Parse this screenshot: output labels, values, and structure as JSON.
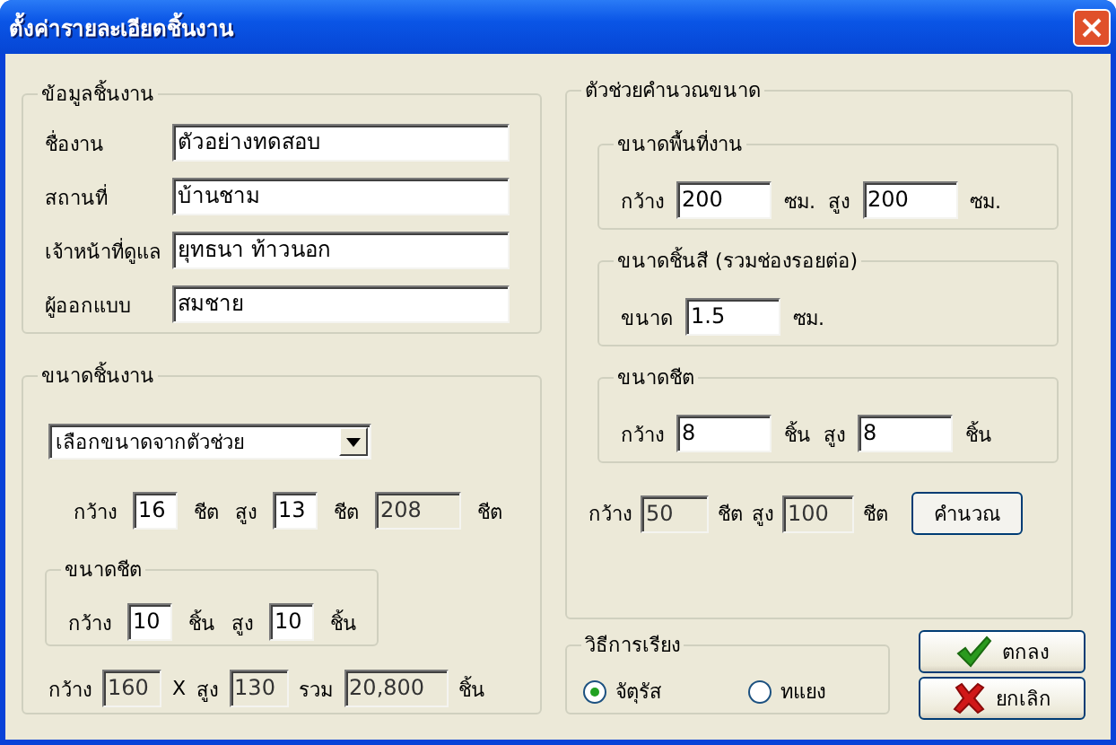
{
  "window": {
    "title": "ตั้งค่ารายละเอียดชิ้นงาน"
  },
  "job_info": {
    "title": "ข้อมูลชิ้นงาน",
    "fields": [
      {
        "label": "ชื่องาน",
        "value": "ตัวอย่างทดสอบ"
      },
      {
        "label": "สถานที่",
        "value": "บ้านชาม"
      },
      {
        "label": "เจ้าหน้าที่ดูแล",
        "value": "ยุทธนา ท้าวนอก"
      },
      {
        "label": "ผู้ออกแบบ",
        "value": "สมชาย"
      }
    ]
  },
  "job_size": {
    "title": "ขนาดชิ้นงาน",
    "dropdown": {
      "value": "เลือกขนาดจากตัวช่วย"
    },
    "size_row": [
      {
        "kind": "label",
        "text": "กว้าง"
      },
      {
        "kind": "input",
        "text": "16"
      },
      {
        "kind": "label",
        "text": "ชีต"
      },
      {
        "kind": "label",
        "text": "สูง"
      },
      {
        "kind": "input",
        "text": "13"
      },
      {
        "kind": "label",
        "text": "ชีต"
      },
      {
        "kind": "readonly",
        "text": "208"
      },
      {
        "kind": "label",
        "text": "ชีต"
      }
    ],
    "sheet_size": {
      "title": "ขนาดชีต",
      "row": [
        {
          "kind": "label",
          "text": "กว้าง"
        },
        {
          "kind": "input",
          "text": "10"
        },
        {
          "kind": "label",
          "text": "ชิ้น"
        },
        {
          "kind": "label",
          "text": "สูง"
        },
        {
          "kind": "input",
          "text": "10"
        },
        {
          "kind": "label",
          "text": "ชิ้น"
        }
      ]
    },
    "result_row": [
      {
        "kind": "label",
        "text": "กว้าง"
      },
      {
        "kind": "readonly",
        "text": "160"
      },
      {
        "kind": "label",
        "text": "X"
      },
      {
        "kind": "label",
        "text": "สูง"
      },
      {
        "kind": "readonly",
        "text": "130"
      },
      {
        "kind": "label",
        "text": "รวม"
      },
      {
        "kind": "readonly",
        "text": "20,800"
      },
      {
        "kind": "label",
        "text": "ชิ้น"
      }
    ]
  },
  "calculator": {
    "title": "ตัวช่วยคำนวณขนาด",
    "groups": [
      {
        "title": "ขนาดพื้นที่งาน",
        "row": [
          {
            "kind": "label",
            "text": "กว้าง"
          },
          {
            "kind": "input",
            "text": "200"
          },
          {
            "kind": "label",
            "text": "ซม."
          },
          {
            "kind": "label",
            "text": "สูง"
          },
          {
            "kind": "input",
            "text": "200"
          },
          {
            "kind": "label",
            "text": "ซม."
          }
        ]
      },
      {
        "title": "ขนาดชิ้นสี (รวมช่องรอยต่อ)",
        "row": [
          {
            "kind": "label",
            "text": "ขนาด"
          },
          {
            "kind": "input",
            "text": "1.5"
          },
          {
            "kind": "label",
            "text": "ซม."
          }
        ]
      },
      {
        "title": "ขนาดชีต",
        "row": [
          {
            "kind": "label",
            "text": "กว้าง"
          },
          {
            "kind": "input",
            "text": "8"
          },
          {
            "kind": "label",
            "text": "ชิ้น"
          },
          {
            "kind": "label",
            "text": "สูง"
          },
          {
            "kind": "input",
            "text": "8"
          },
          {
            "kind": "label",
            "text": "ชิ้น"
          }
        ]
      }
    ],
    "result_row": [
      {
        "kind": "label",
        "text": "กว้าง"
      },
      {
        "kind": "readonly",
        "text": "50"
      },
      {
        "kind": "label",
        "text": "ชีต"
      },
      {
        "kind": "label",
        "text": "สูง"
      },
      {
        "kind": "readonly",
        "text": "100"
      },
      {
        "kind": "label",
        "text": "ชีต"
      }
    ],
    "calculate_button": "คำนวณ"
  },
  "sort_method": {
    "title": "วิธีการเรียง",
    "options": [
      {
        "label": "จัตุรัส",
        "selected": true
      },
      {
        "label": "ทแยง",
        "selected": false
      }
    ]
  },
  "buttons": [
    {
      "kind": "ok",
      "label": "ตกลง"
    },
    {
      "kind": "cancel",
      "label": "ยกเลิก"
    }
  ]
}
